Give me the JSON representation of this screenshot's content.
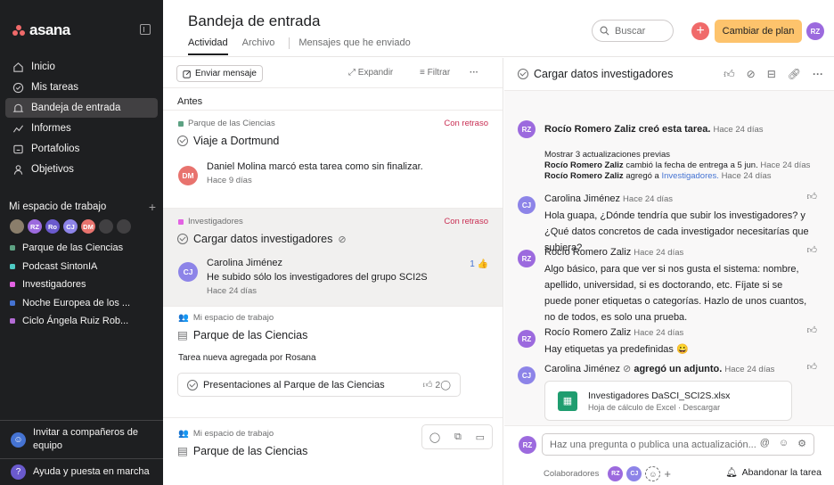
{
  "sidebar": {
    "logo": "asana",
    "nav": [
      {
        "label": "Inicio",
        "icon": "home-icon"
      },
      {
        "label": "Mis tareas",
        "icon": "check-circle-icon"
      },
      {
        "label": "Bandeja de entrada",
        "icon": "bell-icon"
      },
      {
        "label": "Informes",
        "icon": "chart-line-icon"
      },
      {
        "label": "Portafolios",
        "icon": "folder-icon"
      },
      {
        "label": "Objetivos",
        "icon": "person-icon"
      }
    ],
    "workspace_title": "Mi espacio de trabajo",
    "team_avatars": [
      "",
      "RZ",
      "Ro",
      "CJ",
      "DM",
      "",
      ""
    ],
    "projects": [
      {
        "label": "Parque de las Ciencias",
        "color": "#5da283"
      },
      {
        "label": "Podcast SintonIA",
        "color": "#4ecbc4"
      },
      {
        "label": "Investigadores",
        "color": "#e362e3"
      },
      {
        "label": "Noche Europea de los ...",
        "color": "#4573d2"
      },
      {
        "label": "Ciclo Ángela Ruiz Rob...",
        "color": "#b36bd4"
      }
    ],
    "invite": "Invitar a compañeros de equipo",
    "help": "Ayuda y puesta en marcha"
  },
  "header": {
    "title": "Bandeja de entrada",
    "tabs": [
      "Actividad",
      "Archivo",
      "Mensajes que he enviado"
    ],
    "search_placeholder": "Buscar",
    "upgrade": "Cambiar de plan",
    "avatar": "RZ"
  },
  "list": {
    "send_message": "Enviar mensaje",
    "expand": "Expandir",
    "filter": "Filtrar",
    "section": "Antes",
    "cards": [
      {
        "project": "Parque de las Ciencias",
        "project_color": "#5da283",
        "status": "Con retraso",
        "title": "Viaje a Dortmund",
        "avatar": "DM",
        "activity": "Daniel Molina marcó esta tarea como sin finalizar.",
        "time": "Hace 9 días"
      },
      {
        "project": "Investigadores",
        "project_color": "#e362e3",
        "status": "Con retraso",
        "title": "Cargar datos investigadores",
        "avatar": "CJ",
        "author": "Carolina Jiménez",
        "activity": "He subido sólo los investigadores del grupo SCI2S",
        "time": "Hace 24 días",
        "likes": "1"
      },
      {
        "project": "Mi espacio de trabajo",
        "title": "Parque de las Ciencias",
        "note": "Tarea nueva agregada por Rosana",
        "subtask": "Presentaciones al Parque de las Ciencias",
        "comments": "2"
      },
      {
        "project": "Mi espacio de trabajo",
        "title": "Parque de las Ciencias"
      }
    ]
  },
  "detail": {
    "title": "Cargar datos investigadores",
    "created": {
      "name": "Rocío Romero Zaliz",
      "text": "creó esta tarea.",
      "time": "Hace 24 días"
    },
    "show_more": "Mostrar 3 actualizaciones previas",
    "update1": {
      "name": "Rocío Romero Zaliz",
      "text": "cambió la fecha de entrega a 5 jun.",
      "time": "Hace 24 días"
    },
    "update2": {
      "name": "Rocío Romero Zaliz",
      "text": "agregó a",
      "link": "Investigadores.",
      "time": "Hace 24 días"
    },
    "comments": [
      {
        "avatar": "CJ",
        "name": "Carolina Jiménez",
        "time": "Hace 24 días",
        "text": "Hola guapa, ¿Dónde tendría que subir los investigadores? y ¿Qué datos concretos de cada investigador necesitarías que subiera?"
      },
      {
        "avatar": "RZ",
        "name": "Rocío Romero Zaliz",
        "time": "Hace 24 días",
        "text": "Algo básico, para que ver si nos gusta el sistema: nombre, apellido, universidad, si es doctorando, etc. Fíjate si se puede poner etiquetas o categorías. Hazlo de unos cuantos, no de todos, es solo una prueba."
      },
      {
        "avatar": "RZ",
        "name": "Rocío Romero Zaliz",
        "time": "Hace 24 días",
        "text": "Hay etiquetas ya predefinidas 😀"
      },
      {
        "avatar": "CJ",
        "name": "Carolina Jiménez",
        "time": "Hace 24 días",
        "text": "agregó un adjunto."
      }
    ],
    "attachment": {
      "name": "Investigadores DaSCI_SCI2S.xlsx",
      "meta": "Hoja de cálculo de Excel · Descargar"
    },
    "composer_placeholder": "Haz una pregunta o publica una actualización...",
    "collaborators_label": "Colaboradores",
    "leave": "Abandonar la tarea"
  }
}
